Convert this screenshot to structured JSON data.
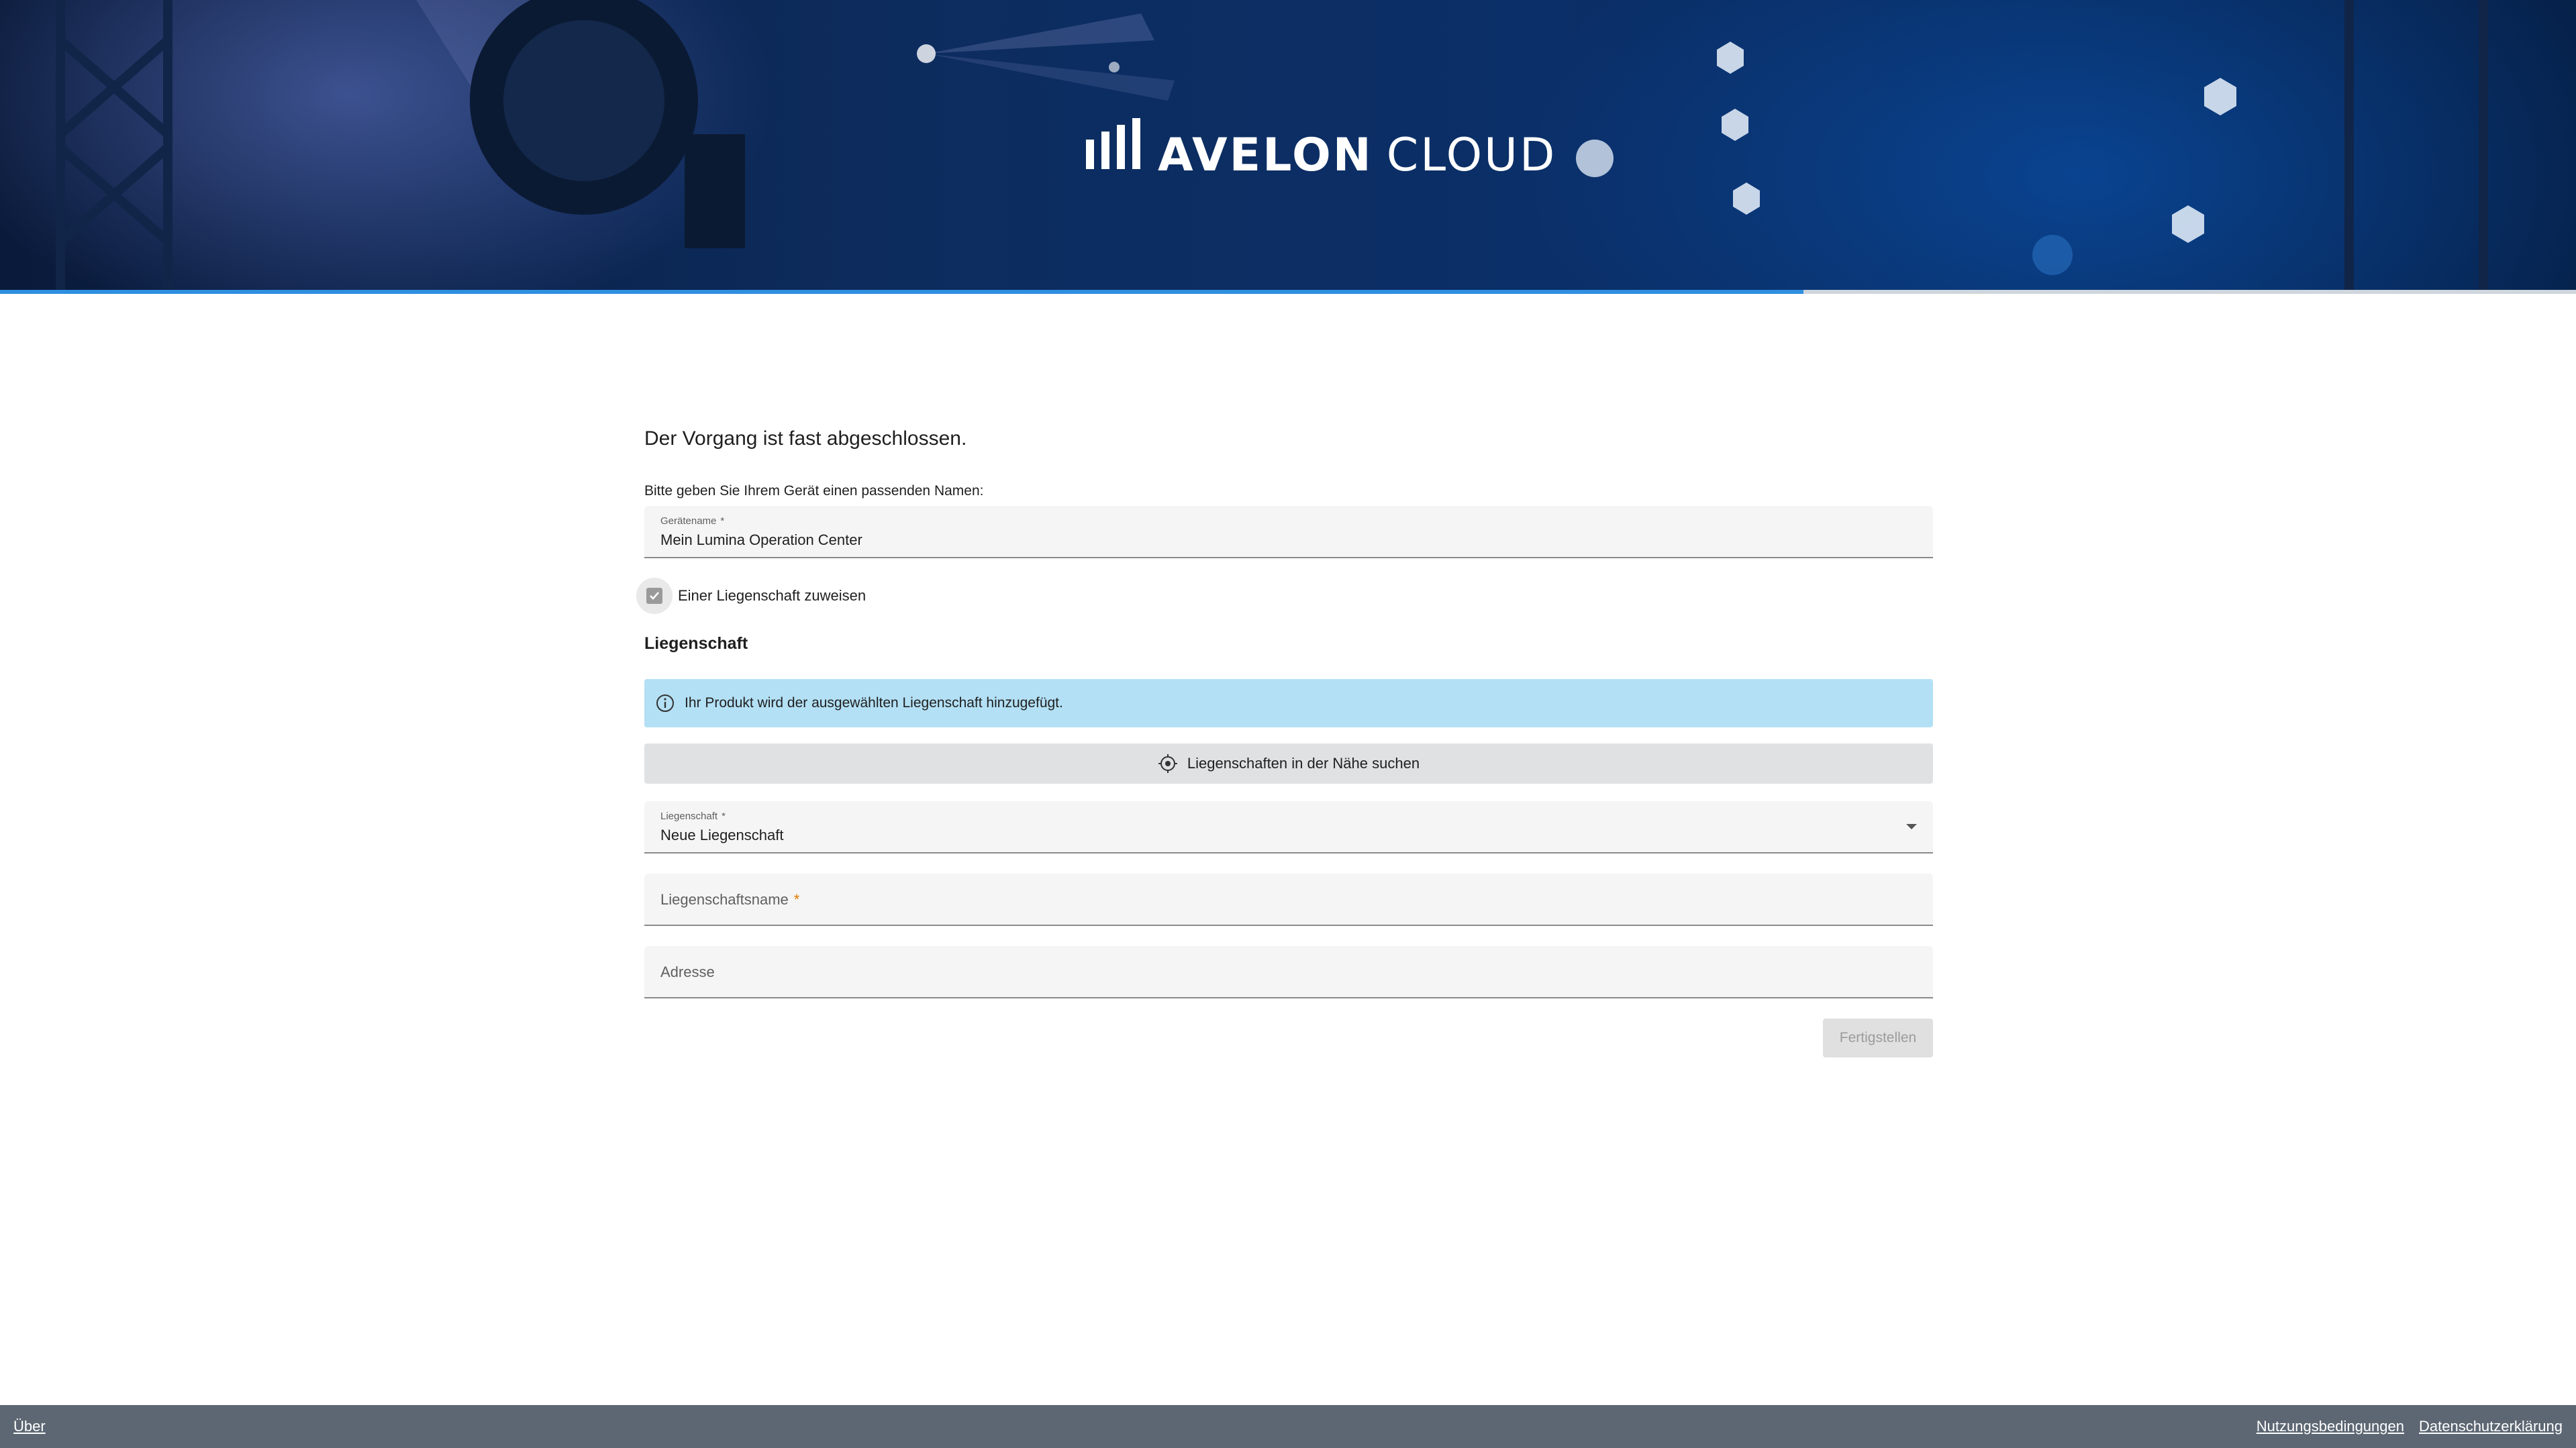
{
  "header": {
    "logo_bold": "AVELON",
    "logo_light": "CLOUD",
    "progress": 0.7
  },
  "form": {
    "heading": "Der Vorgang ist fast abgeschlossen.",
    "instruction": "Bitte geben Sie Ihrem Gerät einen passenden Namen:",
    "device_name": {
      "label": "Gerätename",
      "required_mark": "*",
      "value": "Mein Lumina Operation Center"
    },
    "assign_checkbox": {
      "label": "Einer Liegenschaft zuweisen",
      "checked": true
    },
    "section_title": "Liegenschaft",
    "info_banner": "Ihr Produkt wird der ausgewählten Liegenschaft hinzugefügt.",
    "nearby_button": "Liegenschaften in der Nähe suchen",
    "property_select": {
      "label": "Liegenschaft",
      "required_mark": "*",
      "value": "Neue Liegenschaft"
    },
    "property_name": {
      "label": "Liegenschaftsname",
      "required_mark": "*"
    },
    "address": {
      "label": "Adresse"
    },
    "finish_button": "Fertigstellen"
  },
  "footer": {
    "about": "Über",
    "terms": "Nutzungsbedingungen",
    "privacy": "Datenschutzerklärung"
  },
  "colors": {
    "progress": "#2f8fe0",
    "info_banner": "#b3e0f5",
    "footer": "#5d6773",
    "required_asterisk": "#e07b00"
  }
}
